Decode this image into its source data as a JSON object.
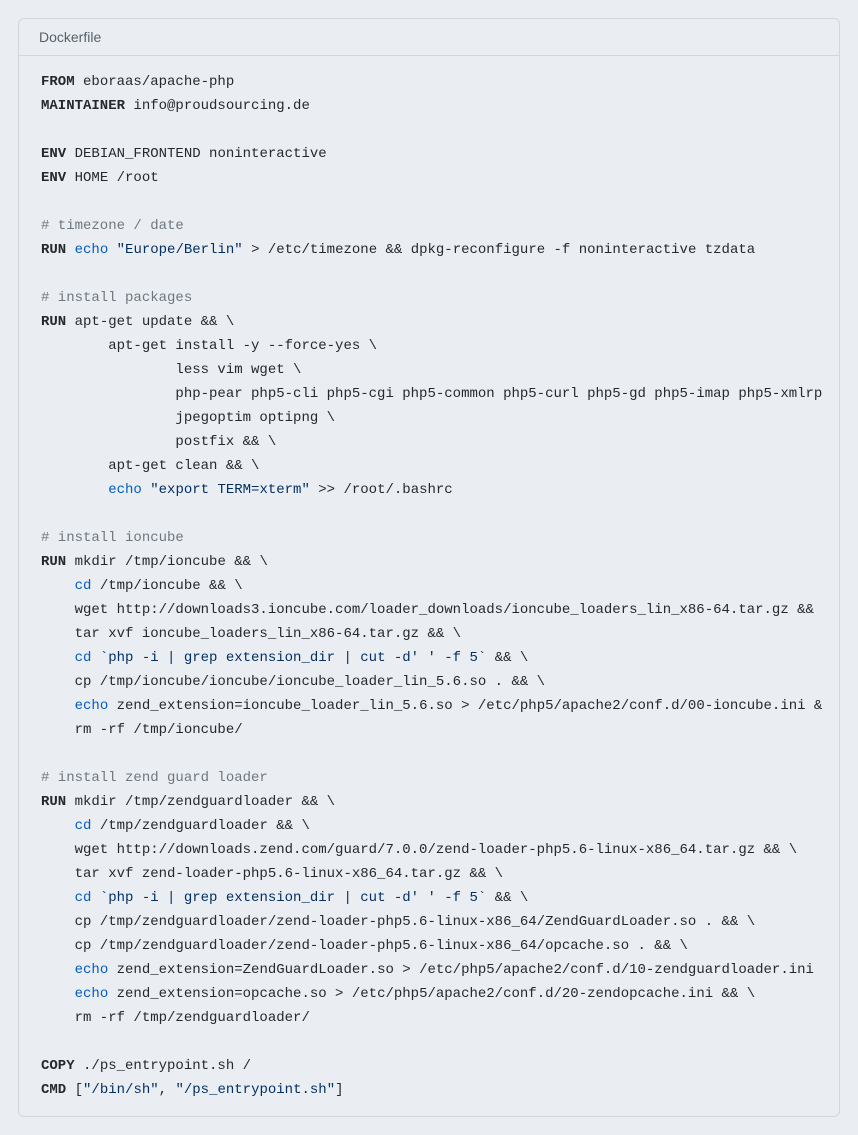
{
  "header": {
    "title": "Dockerfile"
  },
  "code": {
    "lines": [
      [
        {
          "t": "FROM",
          "c": "kw"
        },
        {
          "t": " eboraas/apache-php"
        }
      ],
      [
        {
          "t": "MAINTAINER",
          "c": "kw"
        },
        {
          "t": " info@proudsourcing.de"
        }
      ],
      [],
      [
        {
          "t": "ENV",
          "c": "kw"
        },
        {
          "t": " DEBIAN_FRONTEND noninteractive"
        }
      ],
      [
        {
          "t": "ENV",
          "c": "kw"
        },
        {
          "t": " HOME /root"
        }
      ],
      [],
      [
        {
          "t": "# timezone / date",
          "c": "cmt"
        }
      ],
      [
        {
          "t": "RUN",
          "c": "kw"
        },
        {
          "t": " "
        },
        {
          "t": "echo",
          "c": "cmd"
        },
        {
          "t": " "
        },
        {
          "t": "\"Europe/Berlin\"",
          "c": "str"
        },
        {
          "t": " > /etc/timezone && dpkg-reconfigure -f noninteractive tzdata"
        }
      ],
      [],
      [
        {
          "t": "# install packages",
          "c": "cmt"
        }
      ],
      [
        {
          "t": "RUN",
          "c": "kw"
        },
        {
          "t": " apt-get update && \\"
        }
      ],
      [
        {
          "t": "        apt-get install -y --force-yes \\"
        }
      ],
      [
        {
          "t": "                less vim wget \\"
        }
      ],
      [
        {
          "t": "                php-pear php5-cli php5-cgi php5-common php5-curl php5-gd php5-imap php5-xmlrp"
        }
      ],
      [
        {
          "t": "                jpegoptim optipng \\"
        }
      ],
      [
        {
          "t": "                postfix && \\"
        }
      ],
      [
        {
          "t": "        apt-get clean && \\"
        }
      ],
      [
        {
          "t": "        "
        },
        {
          "t": "echo",
          "c": "cmd"
        },
        {
          "t": " "
        },
        {
          "t": "\"export TERM=xterm\"",
          "c": "str"
        },
        {
          "t": " >> /root/.bashrc"
        }
      ],
      [],
      [
        {
          "t": "# install ioncube",
          "c": "cmt"
        }
      ],
      [
        {
          "t": "RUN",
          "c": "kw"
        },
        {
          "t": " mkdir /tmp/ioncube && \\"
        }
      ],
      [
        {
          "t": "    "
        },
        {
          "t": "cd",
          "c": "cmd"
        },
        {
          "t": " /tmp/ioncube && \\"
        }
      ],
      [
        {
          "t": "    wget http://downloads3.ioncube.com/loader_downloads/ioncube_loaders_lin_x86-64.tar.gz &&"
        }
      ],
      [
        {
          "t": "    tar xvf ioncube_loaders_lin_x86-64.tar.gz && \\"
        }
      ],
      [
        {
          "t": "    "
        },
        {
          "t": "cd",
          "c": "cmd"
        },
        {
          "t": " "
        },
        {
          "t": "`php -i | grep extension_dir | cut -d' ' -f 5`",
          "c": "str"
        },
        {
          "t": " && \\"
        }
      ],
      [
        {
          "t": "    cp /tmp/ioncube/ioncube/ioncube_loader_lin_5.6.so . && \\"
        }
      ],
      [
        {
          "t": "    "
        },
        {
          "t": "echo",
          "c": "cmd"
        },
        {
          "t": " zend_extension=ioncube_loader_lin_5.6.so > /etc/php5/apache2/conf.d/00-ioncube.ini &"
        }
      ],
      [
        {
          "t": "    rm -rf /tmp/ioncube/"
        }
      ],
      [],
      [
        {
          "t": "# install zend guard loader",
          "c": "cmt"
        }
      ],
      [
        {
          "t": "RUN",
          "c": "kw"
        },
        {
          "t": " mkdir /tmp/zendguardloader && \\"
        }
      ],
      [
        {
          "t": "    "
        },
        {
          "t": "cd",
          "c": "cmd"
        },
        {
          "t": " /tmp/zendguardloader && \\"
        }
      ],
      [
        {
          "t": "    wget http://downloads.zend.com/guard/7.0.0/zend-loader-php5.6-linux-x86_64.tar.gz && \\"
        }
      ],
      [
        {
          "t": "    tar xvf zend-loader-php5.6-linux-x86_64.tar.gz && \\"
        }
      ],
      [
        {
          "t": "    "
        },
        {
          "t": "cd",
          "c": "cmd"
        },
        {
          "t": " "
        },
        {
          "t": "`php -i | grep extension_dir | cut -d' ' -f 5`",
          "c": "str"
        },
        {
          "t": " && \\"
        }
      ],
      [
        {
          "t": "    cp /tmp/zendguardloader/zend-loader-php5.6-linux-x86_64/ZendGuardLoader.so . && \\"
        }
      ],
      [
        {
          "t": "    cp /tmp/zendguardloader/zend-loader-php5.6-linux-x86_64/opcache.so . && \\"
        }
      ],
      [
        {
          "t": "    "
        },
        {
          "t": "echo",
          "c": "cmd"
        },
        {
          "t": " zend_extension=ZendGuardLoader.so > /etc/php5/apache2/conf.d/10-zendguardloader.ini"
        }
      ],
      [
        {
          "t": "    "
        },
        {
          "t": "echo",
          "c": "cmd"
        },
        {
          "t": " zend_extension=opcache.so > /etc/php5/apache2/conf.d/20-zendopcache.ini && \\"
        }
      ],
      [
        {
          "t": "    rm -rf /tmp/zendguardloader/"
        }
      ],
      [],
      [
        {
          "t": "COPY",
          "c": "kw"
        },
        {
          "t": " ./ps_entrypoint.sh /"
        }
      ],
      [
        {
          "t": "CMD",
          "c": "kw"
        },
        {
          "t": " ["
        },
        {
          "t": "\"/bin/sh\"",
          "c": "str"
        },
        {
          "t": ", "
        },
        {
          "t": "\"/ps_entrypoint.sh\"",
          "c": "str"
        },
        {
          "t": "]"
        }
      ]
    ]
  }
}
